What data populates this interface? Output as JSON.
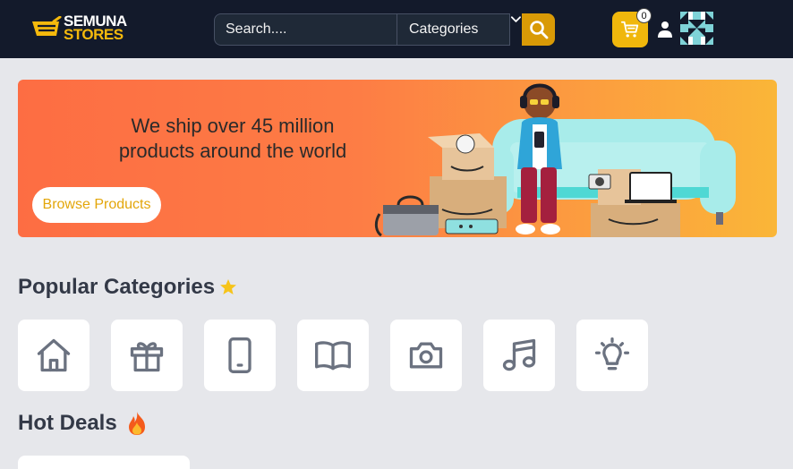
{
  "brand": {
    "line1": "SEMUNA",
    "line2": "STORES"
  },
  "search": {
    "placeholder": "Search....",
    "category_label": "Categories"
  },
  "cart": {
    "count": "0"
  },
  "banner": {
    "headline_line1": "We ship over 45 million",
    "headline_line2": "products around the world",
    "cta": "Browse Products"
  },
  "sections": {
    "popular_categories": "Popular Categories",
    "hot_deals": "Hot Deals"
  },
  "categories": [
    {
      "icon": "home-icon"
    },
    {
      "icon": "gift-icon"
    },
    {
      "icon": "smartphone-icon"
    },
    {
      "icon": "book-icon"
    },
    {
      "icon": "camera-icon"
    },
    {
      "icon": "music-icon"
    },
    {
      "icon": "lightbulb-icon"
    }
  ],
  "colors": {
    "navbar": "#131a2b",
    "accent": "#f0b70c",
    "search_button": "#d99a06",
    "banner_start": "#fd6d43",
    "banner_end": "#fab638",
    "page_bg": "#e6e7eb",
    "icon_gray": "#6b7280"
  }
}
